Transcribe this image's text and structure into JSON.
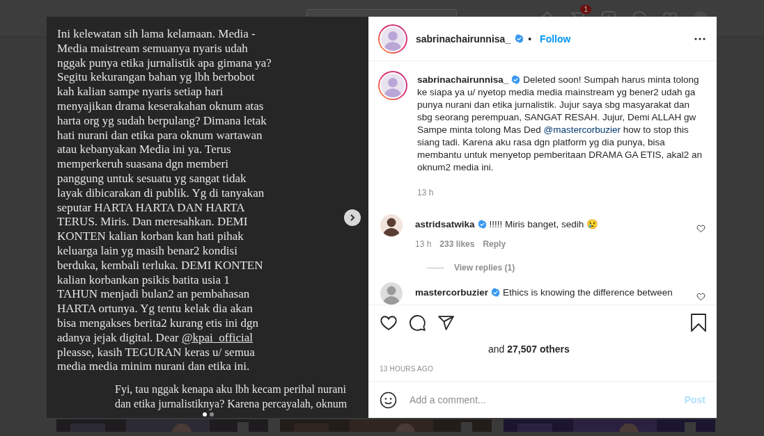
{
  "top_bar": {
    "notification_badge": "1"
  },
  "post_image": {
    "paragraphs": [
      {
        "indent": false,
        "lines": [
          {
            "text": "Ini kelewatan sih lama kelamaan. Media -"
          },
          {
            "text": "Media maistream semuanya nyaris udah"
          },
          {
            "text": "nggak punya etika jurnalistik apa gimana ya?"
          },
          {
            "text": "Segitu kekurangan bahan yg lbh berbobot"
          },
          {
            "text": "kah kalian sampe nyaris setiap hari"
          },
          {
            "text": "menyajikan drama keserakahan oknum atas"
          },
          {
            "text": "harta org yg sudah berpulang? Dimana letak"
          },
          {
            "text": "hati nurani dan etika para oknum wartawan"
          },
          {
            "text": "atau kebanyakan Media ini ya. Terus"
          },
          {
            "text": "memperkeruh suasana dgn memberi"
          },
          {
            "text": "panggung untuk sesuatu yg sangat tidak"
          },
          {
            "text": "layak dibicarakan di publik. Yg di tanyakan"
          },
          {
            "text": "seputar HARTA HARTA DAN HARTA"
          },
          {
            "text": "TERUS. Miris. Dan meresahkan. DEMI"
          },
          {
            "text": "KONTEN kalian korban kan hati pihak"
          },
          {
            "text": "keluarga lain yg masih benar2  kondisi"
          },
          {
            "text": "berduka, kembali terluka. DEMI KONTEN"
          },
          {
            "text": "kalian korbankan psikis batita usia 1"
          },
          {
            "text": "TAHUN menjadi bulan2 an pembahasan"
          },
          {
            "text": "HARTA ortunya. Yg  tentu kelak dia akan"
          },
          {
            "text": "bisa mengakses berita2 kurang etis ini dgn"
          },
          {
            "text": "adanya jejak digital. Dear ",
            "mention": "@kpai_official"
          },
          {
            "text": "pleasse, kasih TEGURAN keras u/ semua"
          },
          {
            "text": "media media minim nurani dan etika ini."
          }
        ]
      },
      {
        "indent": true,
        "lines": [
          {
            "text": "Fyi, tau nggak kenapa aku lbh kecam perihal nurani"
          },
          {
            "text": "dan etika jurnalistiknya? Karena percayalah, oknum"
          }
        ]
      }
    ],
    "carousel_dots": [
      {
        "selected": true
      },
      {
        "selected": false
      }
    ]
  },
  "header": {
    "username": "sabrinachairunnisa_",
    "verified": true,
    "separator": "•",
    "follow": "Follow"
  },
  "caption": {
    "username": "sabrinachairunnisa_",
    "verified": true,
    "text": "Deleted soon! Sumpah harus minta tolong ke siapa ya u/ nyetop media media mainstream yg bener2 udah ga punya nurani dan etika jurnalistik. Jujur saya sbg masyarakat dan sbg seorang perempuan, SANGAT RESAH. Jujur, Demi ALLAH gw Sampe minta tolong Mas Ded ",
    "mention": "@mastercorbuzier",
    "text_after": " how to stop this siang tadi. Karena aku rasa dgn platform yg dia punya, bisa membantu untuk menyetop pemberitaan DRAMA GA ETIS, akal2 an oknum2 media ini.",
    "time": "13 h"
  },
  "comments": [
    {
      "username": "astridsatwika",
      "verified": true,
      "text": "!!!!! Miris banget, sedih 😢",
      "time": "13 h",
      "likes": "233 likes",
      "reply": "Reply",
      "view_replies": "View replies (1)",
      "liked": false
    },
    {
      "username": "mastercorbuzier",
      "verified": true,
      "text": "Ethics is knowing the difference between",
      "liked": false
    }
  ],
  "actions": {
    "liked": false,
    "saved": false
  },
  "likes": "and **27,507 others**",
  "timestamp": "13 HOURS AGO",
  "comment_box": {
    "placeholder": "Add a comment...",
    "post": "Post",
    "disabled": true
  }
}
